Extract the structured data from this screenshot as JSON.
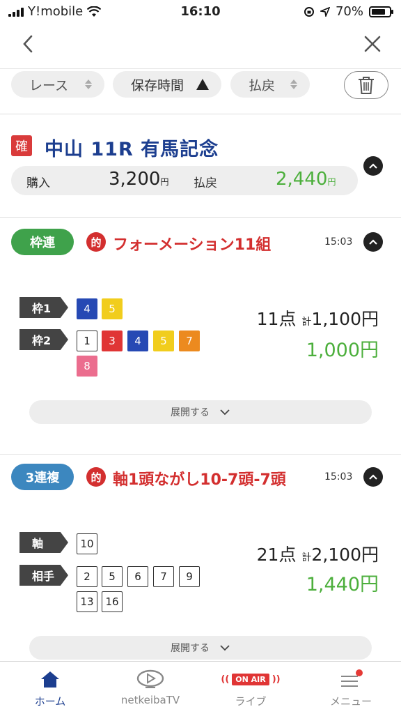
{
  "status": {
    "carrier": "Y!mobile",
    "time": "16:10",
    "battery": "70%"
  },
  "filters": {
    "race": "レース",
    "saved_time": "保存時間",
    "payout": "払戻"
  },
  "race": {
    "confirmed_badge": "確",
    "title": "中山 11R 有馬記念",
    "purchase_label": "購入",
    "purchase_value": "3,200",
    "payout_label": "払戻",
    "payout_value": "2,440",
    "yen": "円"
  },
  "bets": [
    {
      "type": "枠連",
      "type_color": "#3fa24b",
      "hit_badge": "的",
      "title": "フォーメーション11組",
      "time": "15:03",
      "rows": [
        {
          "label": "枠1",
          "numbers": [
            "4",
            "5"
          ]
        },
        {
          "label": "枠2",
          "numbers": [
            "1",
            "3",
            "4",
            "5",
            "7",
            "8"
          ]
        }
      ],
      "points": "11点",
      "total_prefix": "計",
      "total": "1,100円",
      "payout": "1,000円",
      "expand_label": "展開する"
    },
    {
      "type": "3連複",
      "type_color": "#3c87bf",
      "hit_badge": "的",
      "title": "軸1頭ながし10-7頭-7頭",
      "time": "15:03",
      "rows": [
        {
          "label": "軸",
          "numbers": [
            "10"
          ]
        },
        {
          "label": "相手",
          "numbers": [
            "2",
            "5",
            "6",
            "7",
            "9",
            "13",
            "16"
          ]
        }
      ],
      "points": "21点",
      "total_prefix": "計",
      "total": "2,100円",
      "payout": "1,440円",
      "expand_label": "展開する"
    }
  ],
  "tabbar": {
    "home": "ホーム",
    "tv": "netkeibaTV",
    "live": "ライブ",
    "live_badge": "ON AIR",
    "menu": "メニュー"
  }
}
